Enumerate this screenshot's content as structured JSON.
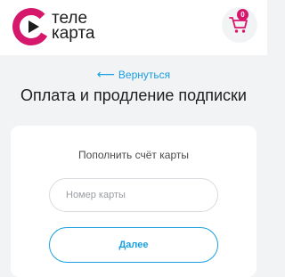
{
  "header": {
    "logo_line1": "теле",
    "logo_line2": "карта",
    "cart_count": "0"
  },
  "nav": {
    "back_label": "Вернуться"
  },
  "page": {
    "title": "Оплата и продление подписки"
  },
  "card": {
    "title": "Пополнить счёт карты",
    "input_placeholder": "Номер карты",
    "submit_label": "Далее"
  },
  "colors": {
    "brand_magenta": "#d6186c",
    "link_blue": "#1a9fe0",
    "background": "#f2f3f5"
  },
  "icons": [
    "telekarta-logo-icon",
    "cart-icon",
    "arrow-left-icon"
  ]
}
